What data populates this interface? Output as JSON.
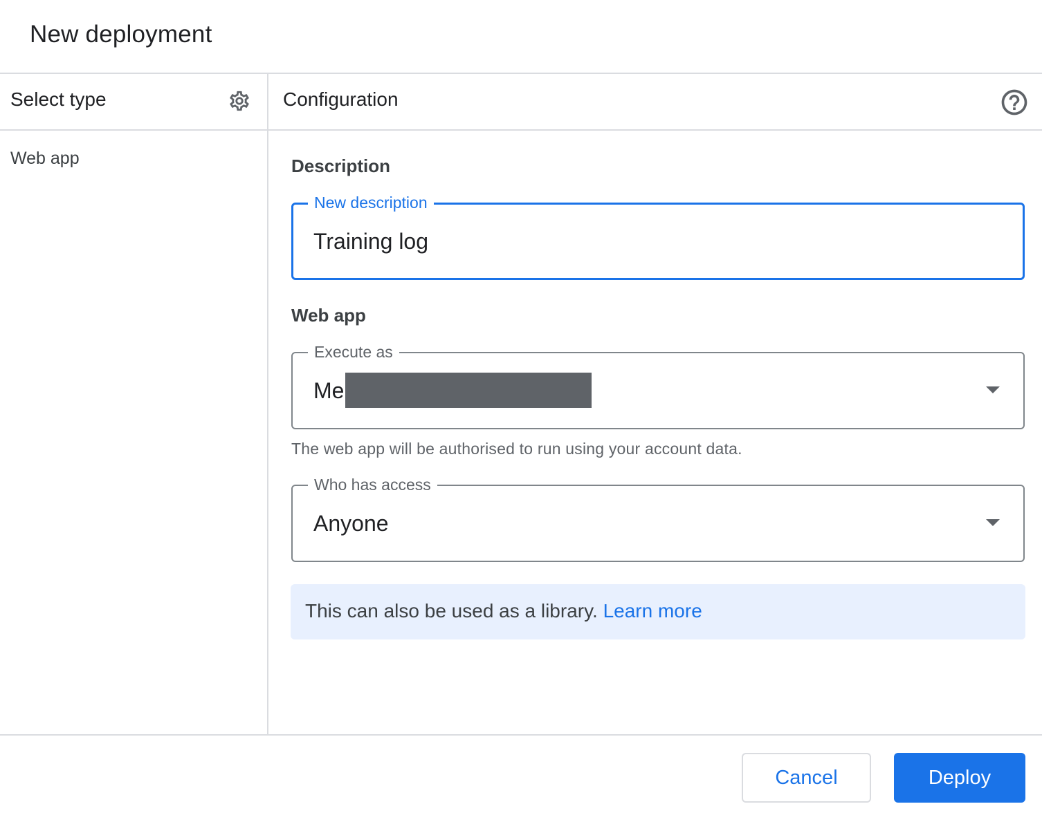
{
  "dialog": {
    "title": "New deployment"
  },
  "left_panel": {
    "header": "Select type",
    "settings_icon": "gear-icon",
    "items": [
      {
        "label": "Web app"
      }
    ]
  },
  "right_panel": {
    "header": "Configuration",
    "help_icon": "help-circle-icon",
    "description_section": {
      "title": "Description",
      "field_label": "New description",
      "field_value": "Training log"
    },
    "webapp_section": {
      "title": "Web app",
      "execute_as": {
        "label": "Execute as",
        "value": "Me"
      },
      "execute_as_hint": "The web app will be authorised to run using your account data.",
      "who_has_access": {
        "label": "Who has access",
        "value": "Anyone"
      }
    },
    "info": {
      "text": "This can also be used as a library.",
      "link": "Learn more"
    }
  },
  "footer": {
    "cancel_label": "Cancel",
    "deploy_label": "Deploy"
  },
  "colors": {
    "accent": "#1a73e8",
    "info_bg": "#e8f0fe",
    "divider": "#dadce0",
    "redaction": "#5f6368"
  }
}
